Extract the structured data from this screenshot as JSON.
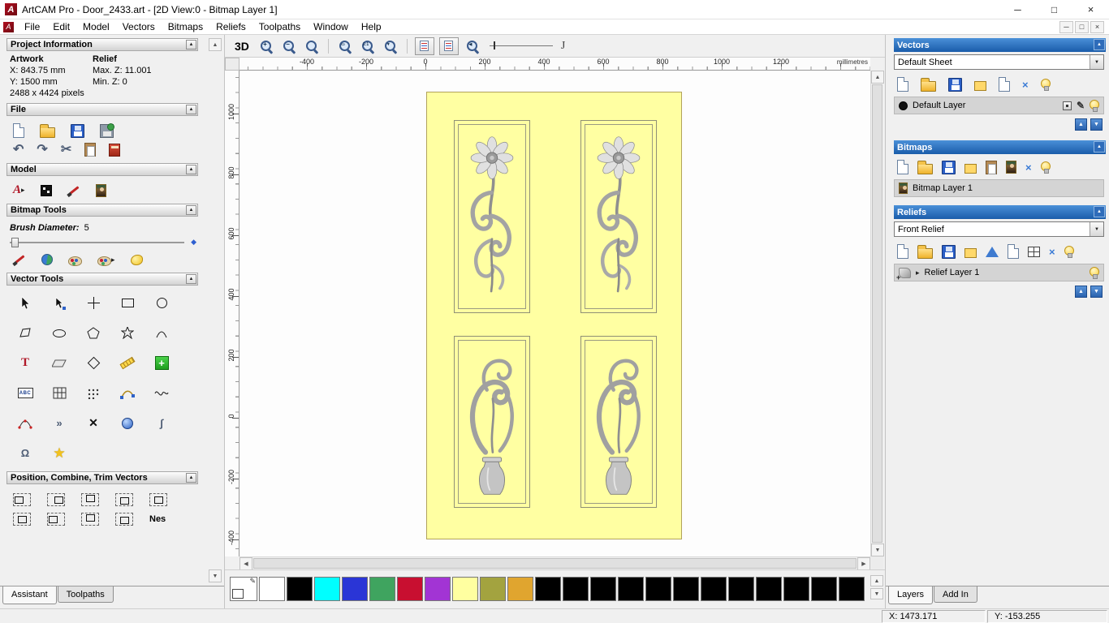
{
  "window": {
    "title": "ArtCAM Pro - Door_2433.art - [2D View:0 - Bitmap Layer 1]"
  },
  "menu": {
    "items": [
      "File",
      "Edit",
      "Model",
      "Vectors",
      "Bitmaps",
      "Reliefs",
      "Toolpaths",
      "Window",
      "Help"
    ]
  },
  "assistant_panel": {
    "project_information": {
      "title": "Project Information",
      "artwork_label": "Artwork",
      "relief_label": "Relief",
      "x": "X: 843.75 mm",
      "y": "Y: 1500 mm",
      "pixels": "2488 x 4424 pixels",
      "max_z": "Max. Z: 11.001",
      "min_z": "Min. Z: 0"
    },
    "file_title": "File",
    "model_title": "Model",
    "bitmap_tools_title": "Bitmap Tools",
    "brush_diameter_label": "Brush Diameter:",
    "brush_diameter_value": "5",
    "vector_tools_title": "Vector Tools",
    "position_title": "Position, Combine, Trim Vectors",
    "nest_label": "Nes",
    "tabs": {
      "assistant": "Assistant",
      "toolpaths": "Toolpaths"
    }
  },
  "view_controls": {
    "btn_3d": "3D",
    "tool_j": "J"
  },
  "rulers": {
    "unit": "millimetres",
    "horizontal": [
      "-400",
      "-200",
      "0",
      "200",
      "400",
      "600",
      "800",
      "1000",
      "1200"
    ],
    "vertical": [
      "1000",
      "800",
      "600",
      "400",
      "200",
      "0",
      "-200",
      "-400"
    ]
  },
  "layers_panel": {
    "vectors": {
      "title": "Vectors",
      "sheet": "Default Sheet",
      "layer": "Default Layer"
    },
    "bitmaps": {
      "title": "Bitmaps",
      "layer": "Bitmap Layer 1"
    },
    "reliefs": {
      "title": "Reliefs",
      "relief": "Front Relief",
      "layer": "Relief Layer 1"
    },
    "tabs": {
      "layers": "Layers",
      "addin": "Add In"
    }
  },
  "palette": {
    "colors": [
      "#ffffff",
      "#000000",
      "#00ffff",
      "#2a35d6",
      "#3fa45f",
      "#c80f30",
      "#a234d4",
      "#ffffa0",
      "#a3a33f",
      "#e0a52f",
      "#000000",
      "#000000",
      "#000000",
      "#000000",
      "#000000",
      "#000000",
      "#000000",
      "#000000",
      "#000000",
      "#000000",
      "#000000",
      "#000000"
    ]
  },
  "status_bar": {
    "x": "X: 1473.171",
    "y": "Y: -153.255"
  },
  "glyphs": {
    "logo": "A",
    "minimize": "─",
    "maximize": "□",
    "close": "×",
    "collapse": "▲",
    "dropdown": "▼",
    "up": "▲",
    "down": "▼",
    "left": "◀",
    "right": "▶",
    "expand": "▸",
    "undo": "↶",
    "redo": "↷",
    "cut": "✂",
    "pencil": "✎",
    "text_tool": "T",
    "abc": "ABC",
    "star": "★",
    "delete": "×",
    "plus": "+",
    "minus": "−",
    "one_to_one": "1:1",
    "window_zoom": "▭",
    "chevrons": "»",
    "integral": "∫",
    "omega": "Ω",
    "diamond": "◆",
    "trim": "✕"
  }
}
